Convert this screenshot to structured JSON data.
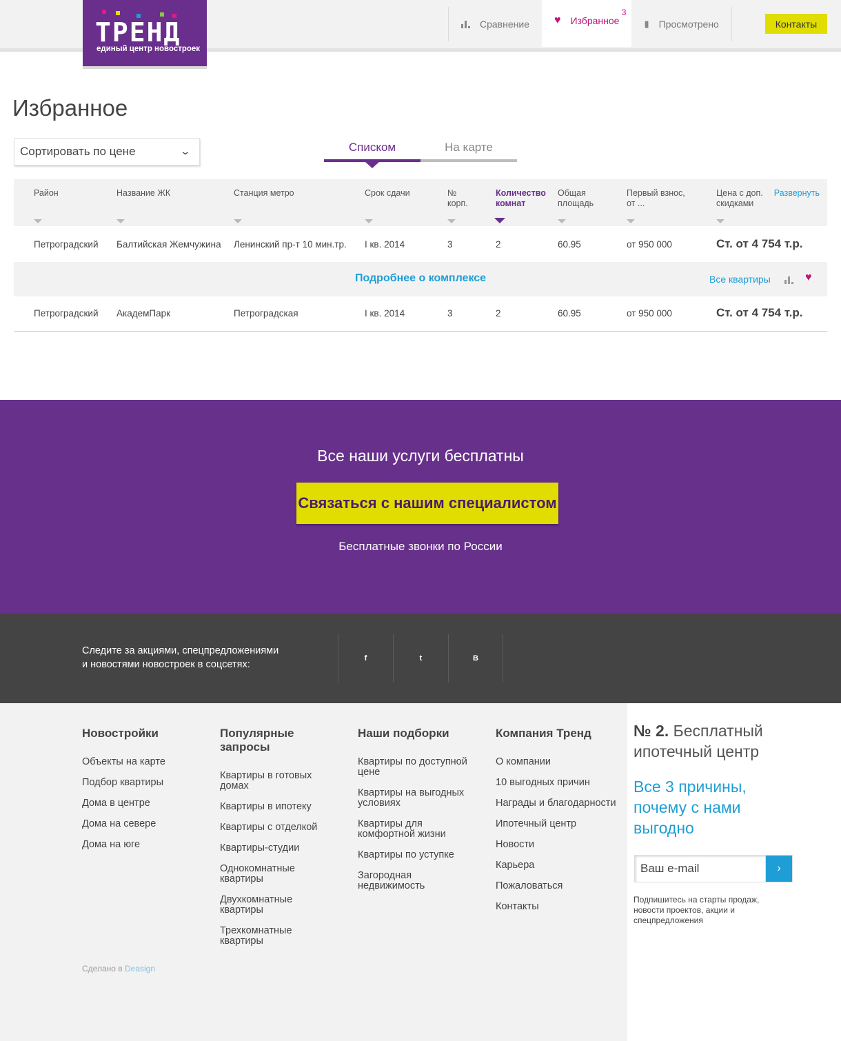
{
  "header": {
    "logo": {
      "word": "ТРЕНД",
      "subtitle": "единый центр новостроек"
    },
    "nav": [
      {
        "label": "Сравнение",
        "icon": "bar-chart-icon"
      },
      {
        "label": "Избранное",
        "icon": "heart-icon",
        "badge": "3"
      },
      {
        "label": "Просмотрено",
        "icon": "document-icon"
      }
    ],
    "contacts_label": "Контакты"
  },
  "page": {
    "title": "Избранное",
    "sort_label": "Сортировать по цене",
    "tabs": [
      {
        "label": "Списком"
      },
      {
        "label": "На карте"
      }
    ]
  },
  "table": {
    "headers": {
      "district": "Район",
      "name": "Название ЖК",
      "metro": "Станция метро",
      "deadline": "Срок сдачи",
      "building": "№ корп.",
      "rooms": "Количество комнат",
      "area": "Общая площадь",
      "payment": "Первый взнос, от ...",
      "price": "Цена с доп. скидками"
    },
    "expand_label": "Развернуть",
    "rows": [
      {
        "district": "Петроградский",
        "name": "Балтийская Жемчужина",
        "metro": "Ленинский пр-т 10 мин.тр.",
        "deadline": "I кв. 2014",
        "building": "3",
        "rooms": "2",
        "area": "60.95",
        "payment": "от 950 000",
        "price": "Ст. от 4 754 т.р."
      },
      {
        "district": "Петроградский",
        "name": "АкадемПарк",
        "metro": "Петроградская",
        "deadline": "I кв. 2014",
        "building": "3",
        "rooms": "2",
        "area": "60.95",
        "payment": "от 950 000",
        "price": "Ст. от 4 754 т.р."
      }
    ],
    "details": {
      "more_label": "Подробнее о комплексе",
      "all_flats_label": "Все квартиры"
    }
  },
  "cta": {
    "title": "Все наши услуги бесплатны",
    "button_label": "Связаться с нашим специалистом",
    "note": "Бесплатные звонки по России"
  },
  "social": {
    "text_line1": "Следите за акциями, спецпредложениями",
    "text_line2": "и новостями новостроек в соцсетях:",
    "networks": [
      {
        "label": "f"
      },
      {
        "label": "t"
      },
      {
        "label": "B"
      }
    ]
  },
  "footer": {
    "columns": [
      {
        "title": "Новостройки",
        "links": [
          "Объекты на карте",
          "Подбор квартиры",
          "Дома в центре",
          "Дома на севере",
          "Дома на юге"
        ]
      },
      {
        "title": "Популярные запросы",
        "links": [
          "Квартиры в готовых домах",
          "Квартиры в ипотеку",
          "Квартиры с отделкой",
          "Квартиры-студии",
          "Однокомнатные квартиры",
          "Двухкомнатные квартиры",
          "Трехкомнатные квартиры"
        ]
      },
      {
        "title": "Наши подборки",
        "links": [
          "Квартиры по доступной цене",
          "Квартиры на выгодных условиях",
          "Квартиры для комфортной жизни",
          "Квартиры по уступке",
          "Загородная недвижимость"
        ]
      },
      {
        "title": "Компания Тренд",
        "links": [
          "О компании",
          "10 выгодных причин",
          "Награды и благодарности",
          "Ипотечный центр",
          "Новости",
          "Карьера",
          "Пожаловаться",
          "Контакты"
        ]
      }
    ],
    "made_prefix": "Сделано в",
    "made_link": "Deasign"
  },
  "sidebar": {
    "title_bold": "№ 2.",
    "title_rest": "Бесплатный ипотечный центр",
    "promo": "Все 3 причины, почему с нами выгодно",
    "email_placeholder": "Ваш e-mail",
    "note": "Подпишитесь на старты продаж, новости проектов, акции и спецпредложения"
  },
  "colors": {
    "brand_purple": "#67308b",
    "accent_yellow": "#e1dd00",
    "link_blue": "#1e9ed6",
    "favorite_pink": "#c2127e",
    "dark_band": "#444444"
  }
}
